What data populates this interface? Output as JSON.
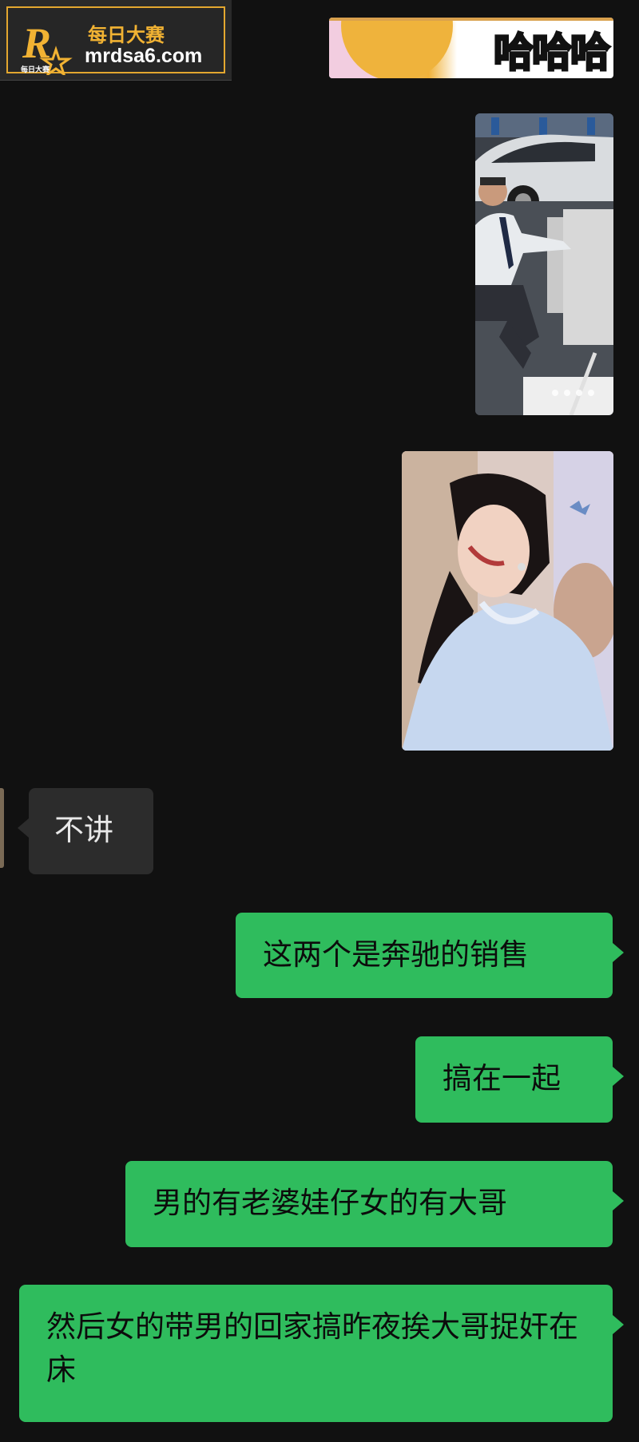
{
  "watermark": {
    "title": "每日大赛",
    "url": "mrdsa6.com",
    "logo_icon": "r-star-logo",
    "logo_subtext": "每日大赛"
  },
  "images": {
    "top_sticker_text": "哈哈哈",
    "car_photo_icon": "photo-man-car-showroom",
    "woman_photo_icon": "photo-woman-smiling"
  },
  "messages": [
    {
      "side": "left",
      "text": "不讲"
    },
    {
      "side": "right",
      "text": "这两个是奔驰的销售"
    },
    {
      "side": "right",
      "text": "搞在一起"
    },
    {
      "side": "right",
      "text": "男的有老婆娃仔女的有大哥"
    },
    {
      "side": "right",
      "text": "然后女的带男的回家搞昨夜挨大哥捉奸在床"
    }
  ],
  "colors": {
    "background": "#111111",
    "bubble_left": "#2c2c2c",
    "bubble_right": "#2fbc5d",
    "watermark_accent": "#e3a72f"
  }
}
